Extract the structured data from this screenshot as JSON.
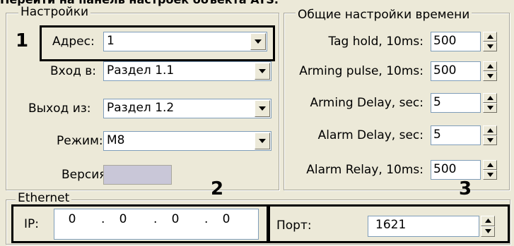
{
  "top_text": "Перейти на панель настроек объекта ATS.",
  "settings": {
    "legend": "Настройки",
    "address_label": "Адрес:",
    "address_value": "1",
    "input_label": "Вход в:",
    "input_value": "Раздел 1.1",
    "output_label": "Выход из:",
    "output_value": "Раздел 1.2",
    "mode_label": "Режим:",
    "mode_value": "M8",
    "version_label": "Версия:"
  },
  "timing": {
    "legend": "Общие настройки времени",
    "rows": [
      {
        "label": "Tag hold, 10ms:",
        "value": "500"
      },
      {
        "label": "Arming pulse, 10ms:",
        "value": "500"
      },
      {
        "label": "Arming Delay, sec:",
        "value": "5"
      },
      {
        "label": "Alarm Delay, sec:",
        "value": "5"
      },
      {
        "label": "Alarm Relay, 10ms:",
        "value": "500"
      }
    ]
  },
  "ethernet": {
    "legend": "Ethernet",
    "ip_label": "IP:",
    "ip_octets": [
      "0",
      "0",
      "0",
      "0"
    ],
    "ip_separator": ".",
    "port_label": "Порт:",
    "port_value": "1621"
  },
  "callouts": {
    "one": "1",
    "two": "2",
    "three": "3"
  }
}
